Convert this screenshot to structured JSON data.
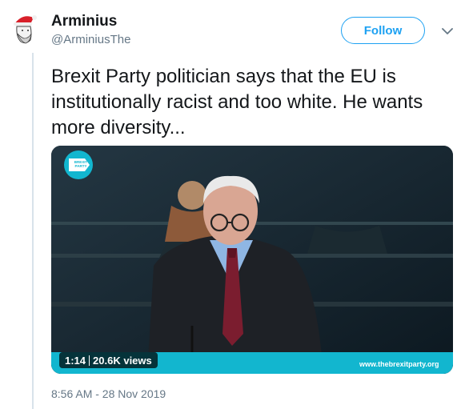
{
  "tweet": {
    "author_name": "Arminius",
    "author_handle": "@ArminiusThe",
    "follow_label": "Follow",
    "text": "Brexit Party politician says that the EU is institutionally racist and too white. He wants more diversity...",
    "timestamp": "8:56 AM - 28 Nov 2019"
  },
  "media": {
    "duration": "1:14",
    "views": "20.6K views",
    "logo_text_line1": "BREXIT",
    "logo_text_line2": "PARTY",
    "site_url": "www.thebrexitparty.org"
  },
  "colors": {
    "accent": "#1da1f2",
    "brand_teal": "#12b6cf"
  },
  "icons": {
    "caret": "chevron-down-icon",
    "avatar": "avatar"
  }
}
